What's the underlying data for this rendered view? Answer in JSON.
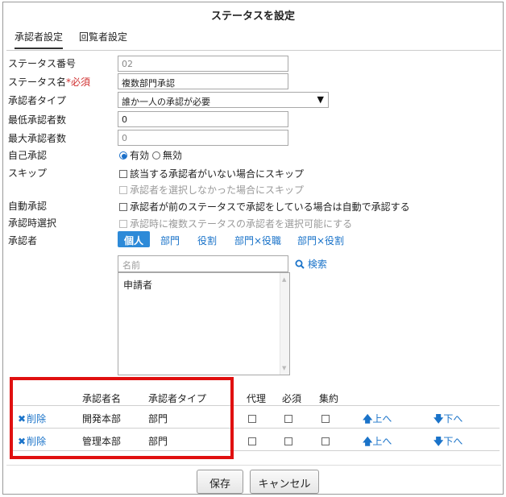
{
  "dialog": {
    "title": "ステータスを設定",
    "tabs": [
      {
        "label": "承認者設定",
        "active": true
      },
      {
        "label": "回覧者設定",
        "active": false
      }
    ]
  },
  "form": {
    "status_number": {
      "label": "ステータス番号",
      "value": "02"
    },
    "status_name": {
      "label": "ステータス名",
      "required_mark": "*必須",
      "value": "複数部門承認"
    },
    "approver_type": {
      "label": "承認者タイプ",
      "value": "誰か一人の承認が必要"
    },
    "min_approvers": {
      "label": "最低承認者数",
      "value": "0"
    },
    "max_approvers": {
      "label": "最大承認者数",
      "value": "0"
    },
    "self_approval": {
      "label": "自己承認",
      "options": [
        "有効",
        "無効"
      ],
      "selected": "有効"
    },
    "skip": {
      "label": "スキップ",
      "options": [
        {
          "text": "該当する承認者がいない場合にスキップ",
          "checked": false,
          "disabled": false
        },
        {
          "text": "承認者を選択しなかった場合にスキップ",
          "checked": false,
          "disabled": true
        }
      ]
    },
    "auto_approval": {
      "label": "自動承認",
      "text": "承認者が前のステータスで承認をしている場合は自動で承認する",
      "checked": false
    },
    "select_on_approval": {
      "label": "承認時選択",
      "text": "承認時に複数ステータスの承認者を選択可能にする",
      "checked": false,
      "disabled": true
    }
  },
  "approver": {
    "label": "承認者",
    "segments": [
      "個人",
      "部門",
      "役割",
      "部門×役職",
      "部門×役割"
    ],
    "active_segment": "個人",
    "search_placeholder": "名前",
    "search_button": "検索",
    "candidates": [
      "申請者"
    ]
  },
  "table": {
    "headers": {
      "name": "承認者名",
      "type": "承認者タイプ",
      "proxy": "代理",
      "required": "必須",
      "aggregate": "集約"
    },
    "delete_label": "削除",
    "up_label": "上へ",
    "down_label": "下へ",
    "rows": [
      {
        "name": "開発本部",
        "type": "部門",
        "proxy": false,
        "required": false,
        "aggregate": false
      },
      {
        "name": "管理本部",
        "type": "部門",
        "proxy": false,
        "required": false,
        "aggregate": false
      }
    ]
  },
  "footer": {
    "save": "保存",
    "cancel": "キャンセル"
  },
  "colors": {
    "accent": "#2d8ad8",
    "link": "#1a73c9",
    "required": "#d03030",
    "highlight": "#e01010"
  },
  "icons": {
    "delete": "close-icon",
    "search": "search-icon",
    "up": "arrow-up-icon",
    "down": "arrow-down-icon",
    "dropdown": "triangle-down-icon"
  }
}
